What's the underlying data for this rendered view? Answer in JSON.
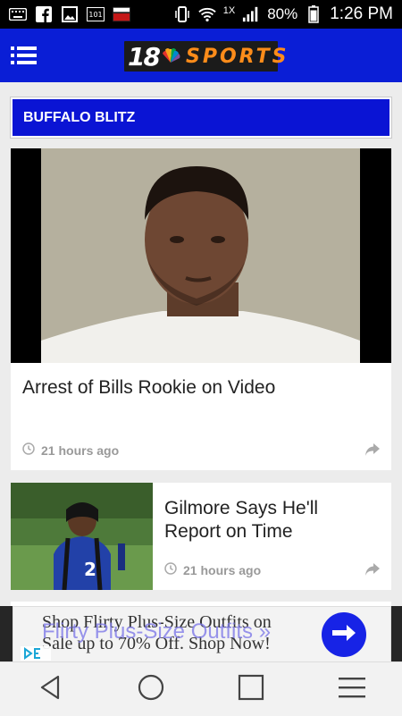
{
  "status_bar": {
    "battery_percent": "80%",
    "time": "1:26 PM",
    "data_badge": "1X"
  },
  "app": {
    "logo_number": "18",
    "logo_text": "SPORTS"
  },
  "section": {
    "title": "BUFFALO BLITZ"
  },
  "articles": [
    {
      "title": "Arrest of Bills Rookie on Video",
      "time": "21 hours ago"
    },
    {
      "title": "Gilmore Says He'll Report on Time",
      "time": "21 hours ago"
    }
  ],
  "ad": {
    "line1": "Shop Flirty Plus-Size Outfits on",
    "line2": "Sale up to 70% Off. Shop Now!",
    "overlay": "Flirty Plus-Size Outfits »"
  },
  "colors": {
    "brand_blue": "#0a1ed6",
    "logo_orange": "#ff8c1a",
    "ad_button": "#1723e6"
  }
}
